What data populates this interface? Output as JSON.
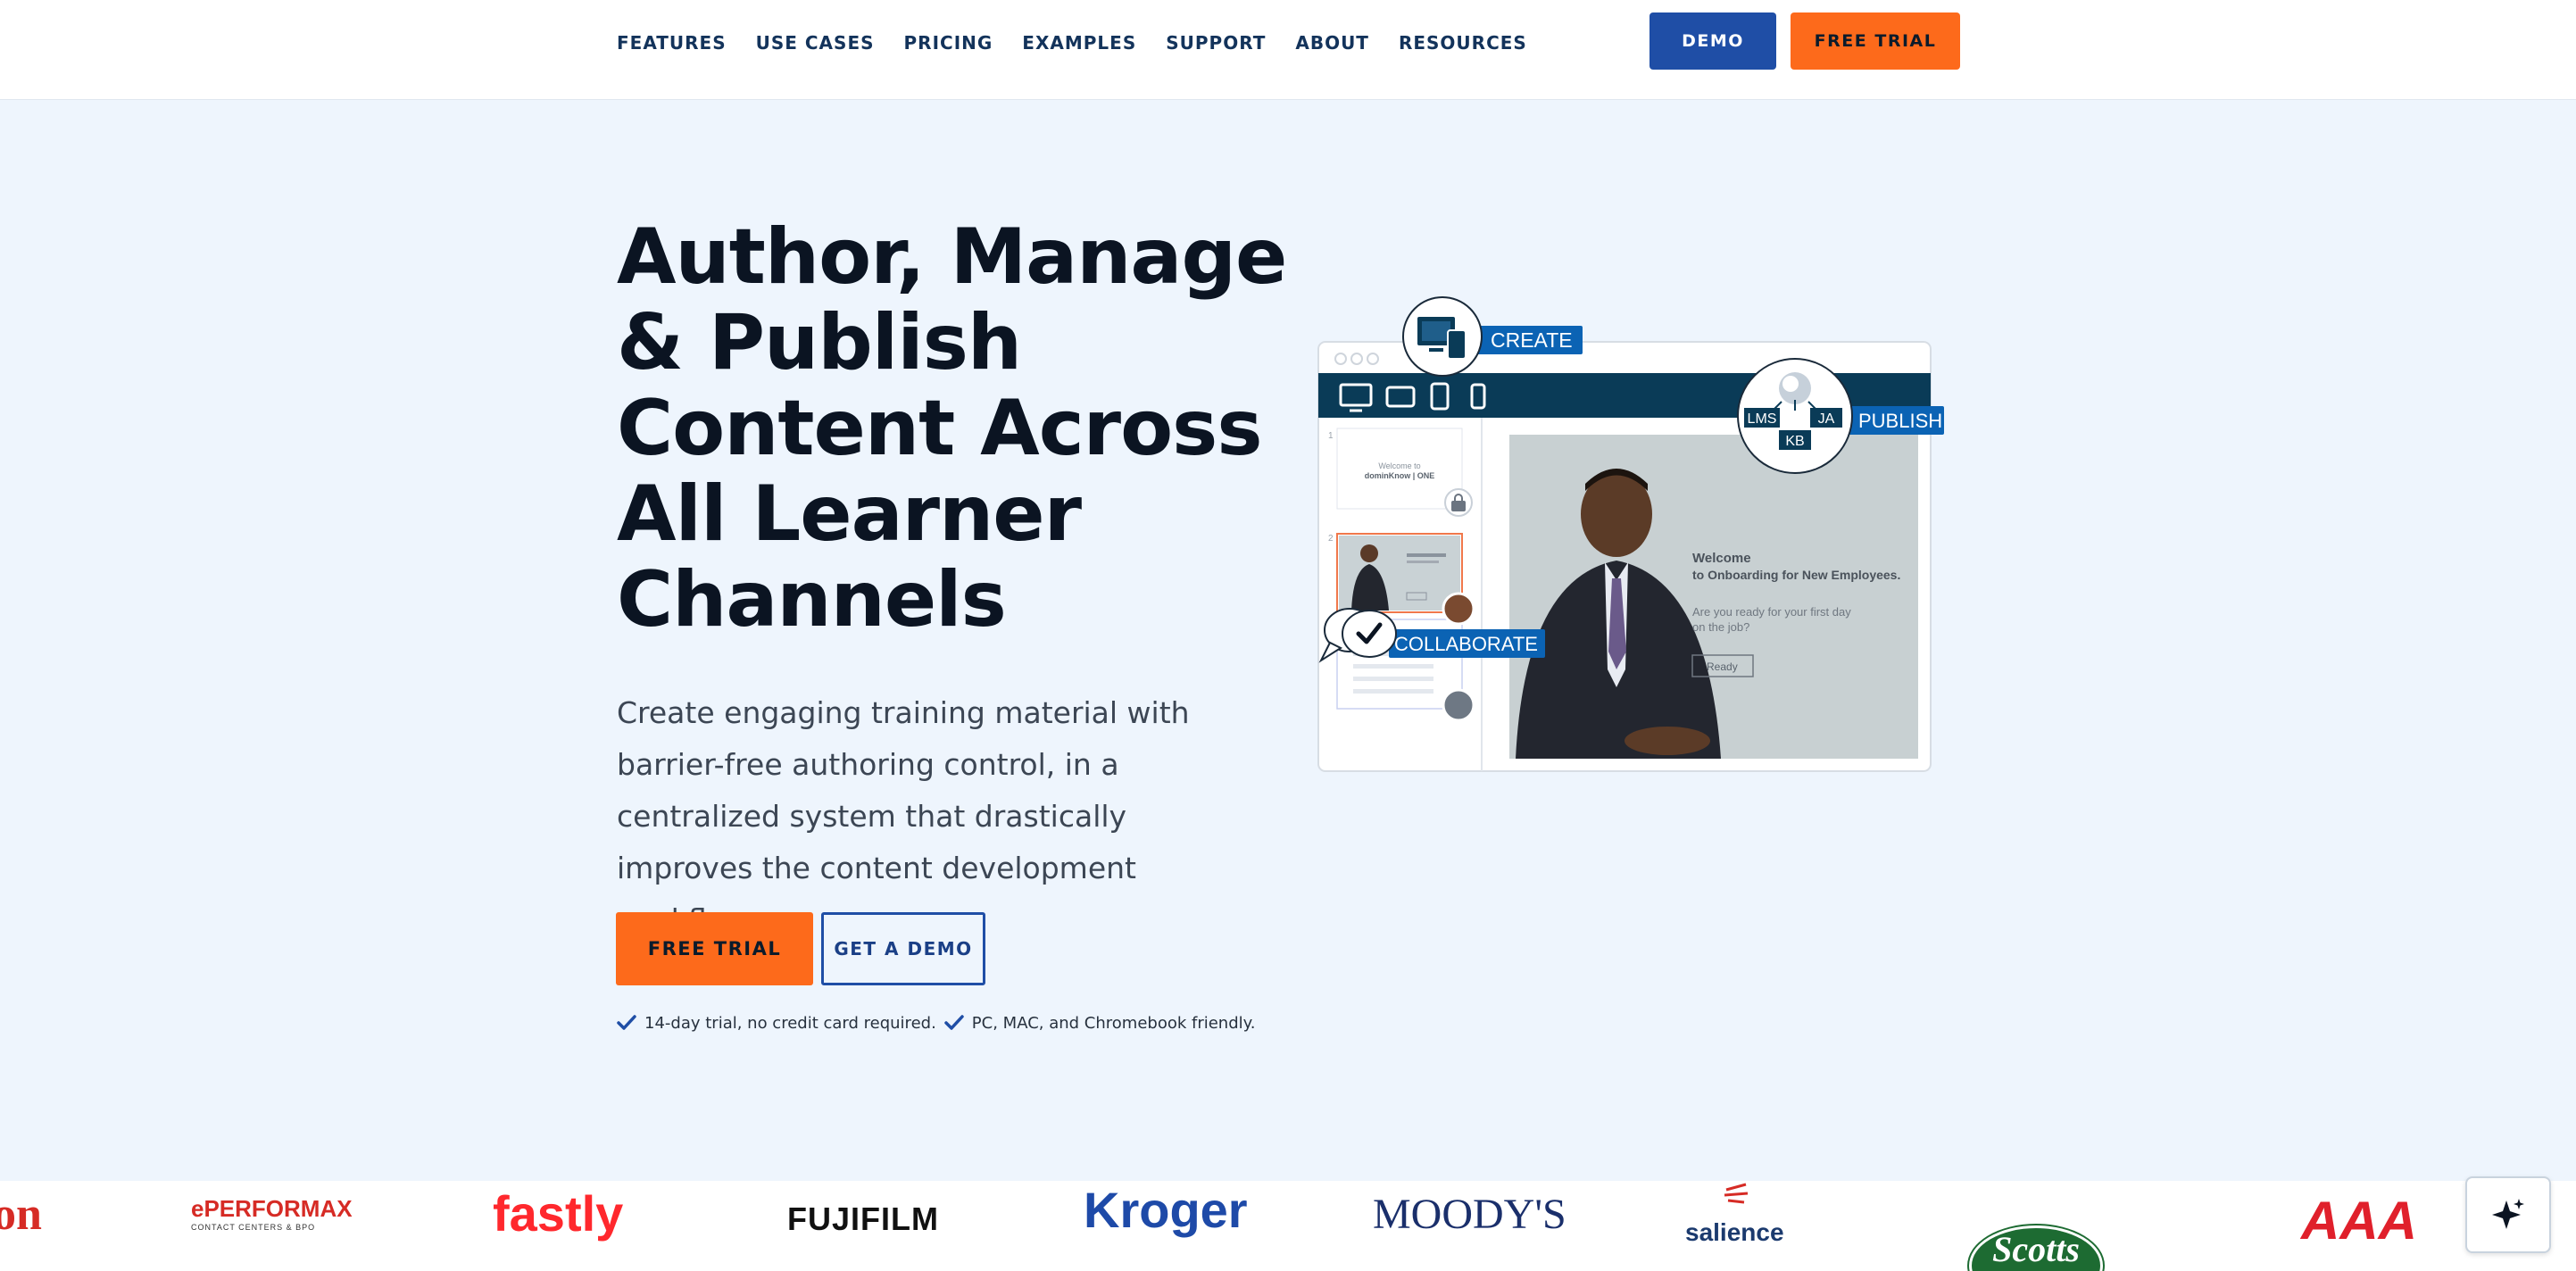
{
  "nav": {
    "items": [
      "FEATURES",
      "USE CASES",
      "PRICING",
      "EXAMPLES",
      "SUPPORT",
      "ABOUT",
      "RESOURCES"
    ],
    "demo_label": "DEMO",
    "trial_label": "FREE TRIAL"
  },
  "hero": {
    "title_lines": [
      "Author, Manage",
      "& Publish",
      "Content Across",
      "All Learner",
      "Channels"
    ],
    "subtitle": "Create engaging training material with barrier-free authoring control, in a centralized system that drastically improves the content development workflow.",
    "cta_trial": "FREE TRIAL",
    "cta_demo": "GET A DEMO",
    "notes": [
      "14-day trial, no credit card required.",
      "PC, MAC, and Chromebook friendly."
    ]
  },
  "illustration": {
    "create_label": "CREATE",
    "publish_label": "PUBLISH",
    "collaborate_label": "COLLABORATE",
    "publish_badges": [
      "LMS",
      "JA",
      "KB"
    ],
    "thumb1_text": "Welcome to",
    "thumb1_brand": "dominKnow | ONE",
    "slide_welcome": "Welcome",
    "slide_heading": "to Onboarding for New Employees.",
    "slide_question": "Are you ready for your first day on the job?",
    "slide_button": "Ready",
    "accent": "#0b63b4",
    "toolbar_color": "#0a3b57"
  },
  "logos": [
    "on",
    "ePERFORMAX",
    "fastly",
    "FUJIFILM",
    "Kroger",
    "MOODY'S",
    "salience",
    "Scotts",
    "AAA"
  ],
  "logo_sub": "CONTACT CENTERS & BPO",
  "colors": {
    "orange": "#fd6a1b",
    "blue": "#1f4ea6",
    "navy": "#13335b",
    "hero_bg": "#eef5fd"
  }
}
